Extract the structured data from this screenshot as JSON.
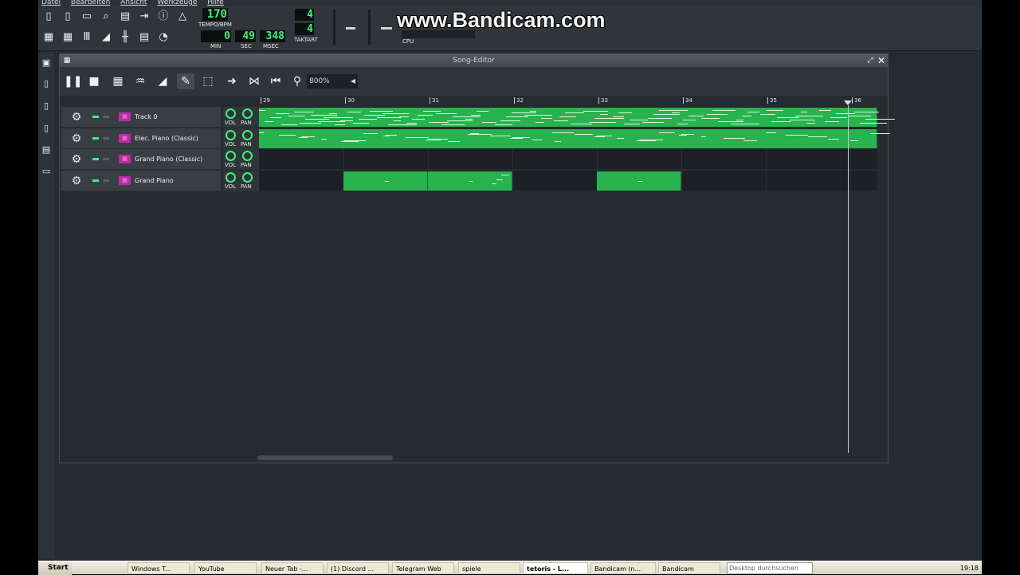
{
  "menu": [
    "Datei",
    "Bearbeiten",
    "Ansicht",
    "Werkzeuge",
    "Hilfe"
  ],
  "watermark": "www.Bandicam.com",
  "lcd": {
    "tempo": "170",
    "tempo_label": "TEMPO/BPM",
    "min": "0",
    "sec": "49",
    "msec": "348",
    "min_label": "MIN",
    "sec_label": "SEC",
    "msec_label": "MSEC",
    "ts_top": "4",
    "ts_bottom": "4",
    "ts_label": "TAKTART",
    "cpu_label": "CPU"
  },
  "song_editor": {
    "title": "Song-Editor",
    "zoom": "800%",
    "bars": [
      "29",
      "30",
      "31",
      "32",
      "33",
      "34",
      "35",
      "36"
    ],
    "tracks": [
      {
        "name": "Track 0",
        "vol_label": "VOL",
        "pan_label": "PAN"
      },
      {
        "name": "Elec. Piano (Classic)",
        "vol_label": "VOL",
        "pan_label": "PAN"
      },
      {
        "name": "Grand Piano (Classic)",
        "vol_label": "VOL",
        "pan_label": "PAN"
      },
      {
        "name": "Grand Piano",
        "vol_label": "VOL",
        "pan_label": "PAN"
      }
    ]
  },
  "taskbar": {
    "start": "Start",
    "tasks": [
      "Windows T...",
      "YouTube",
      "Neuer Tab -...",
      "(1) Discord ...",
      "Telegram Web",
      "spiele",
      "tetoris - L...",
      "Bandicam (n...",
      "Bandicam"
    ],
    "search_placeholder": "Desktop durchsuchen",
    "clock": "19:18"
  }
}
